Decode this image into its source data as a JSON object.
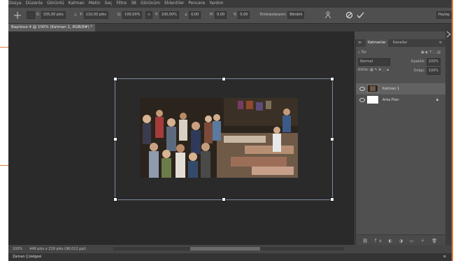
{
  "menu": [
    "Dosya",
    "Düzenle",
    "Görüntü",
    "Katman",
    "Metin",
    "Seç",
    "Filtre",
    "3B",
    "Görünüm",
    "Eklentiler",
    "Pencere",
    "Yardım"
  ],
  "options": {
    "x_label": "X:",
    "x_value": "335,00 piks",
    "y_label": "Y:",
    "y_value": "110,00 piks",
    "w_label": "G:",
    "w_value": "100,00%",
    "h_label": "Y:",
    "h_value": "100,00%",
    "angle_value": "0,00",
    "h_skew_value": "0,00",
    "v_skew_value": "0,00",
    "interpolation_label": "Enterpolasyon:",
    "interpolation_value": "Bikübik",
    "right_label": "Paylaş"
  },
  "document_tab": "Başlıksız-4 @ 100% (Katman 1, RGB/8#) *",
  "layers_panel": {
    "tab_layers": "Katmanlar",
    "tab_channels": "Kanallar",
    "kind_label": "Tür",
    "blend_mode": "Normal",
    "opacity_label": "Opaklık:",
    "opacity_value": "100%",
    "lock_label": "Kilitle:",
    "fill_label": "Dolgu:",
    "fill_value": "100%",
    "layers": [
      {
        "name": "Katman 1",
        "selected": true
      },
      {
        "name": "Arka Plan",
        "selected": false
      }
    ]
  },
  "status": {
    "zoom": "100%",
    "doc_size": "448 piks x 228 piks (96,012 ppi)"
  },
  "timeline_label": "Zaman Çizelgesi",
  "colors": {
    "accent_orange": "#e07a3c",
    "canvas_bg": "#2a2a2a",
    "panel_bg": "#505050"
  }
}
